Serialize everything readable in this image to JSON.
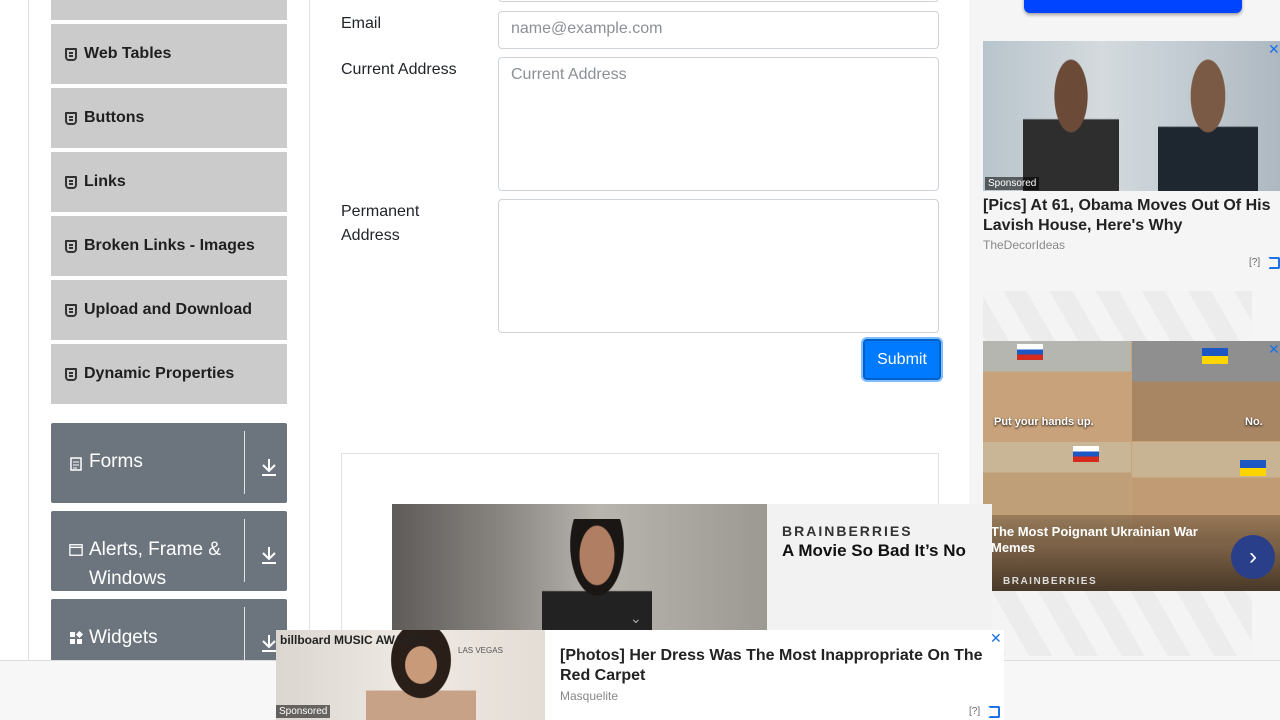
{
  "sidebar": {
    "items": [
      {
        "label": "Web Tables"
      },
      {
        "label": "Buttons"
      },
      {
        "label": "Links"
      },
      {
        "label": "Broken Links - Images"
      },
      {
        "label": "Upload and Download"
      },
      {
        "label": "Dynamic Properties"
      }
    ],
    "groups": [
      {
        "label": "Forms"
      },
      {
        "label": "Alerts, Frame & Windows"
      },
      {
        "label": "Widgets"
      }
    ]
  },
  "form": {
    "email_label": "Email",
    "email_placeholder": "name@example.com",
    "current_address_label": "Current Address",
    "current_address_placeholder": "Current Address",
    "permanent_address_label": "Permanent Address",
    "submit_label": "Submit"
  },
  "ads": {
    "right_top": {
      "sponsored": "Sponsored",
      "title": "[Pics] At 61, Obama Moves Out Of His Lavish House, Here's Why",
      "source": "TheDecorIdeas",
      "info": "[?]"
    },
    "right_bottom": {
      "caption_left": "Put your hands up.",
      "caption_right": "No.",
      "title": "The Most Poignant Ukrainian War Memes",
      "brand": "BRAINBERRIES"
    },
    "video": {
      "brand": "BRAINBERRIES",
      "title": "A Movie So Bad It’s No"
    },
    "bottom": {
      "sponsored": "Sponsored",
      "title": "[Photos] Her Dress Was The Most Inappropriate On The Red Carpet",
      "source": "Masquelite",
      "info": "[?]",
      "image_text": "billboard MUSIC AWARDS",
      "image_text_2": "LAS VEGAS"
    },
    "close_glyph": "✕"
  },
  "icons": {
    "html": "html5-icon",
    "form": "form-icon",
    "window": "window-icon",
    "widgets": "widgets-icon",
    "download": "download-icon",
    "next": "next-arrow-icon"
  },
  "colors": {
    "primary": "#007bff",
    "menu_bg": "#cbcbcb",
    "group_bg": "#6c757d"
  }
}
